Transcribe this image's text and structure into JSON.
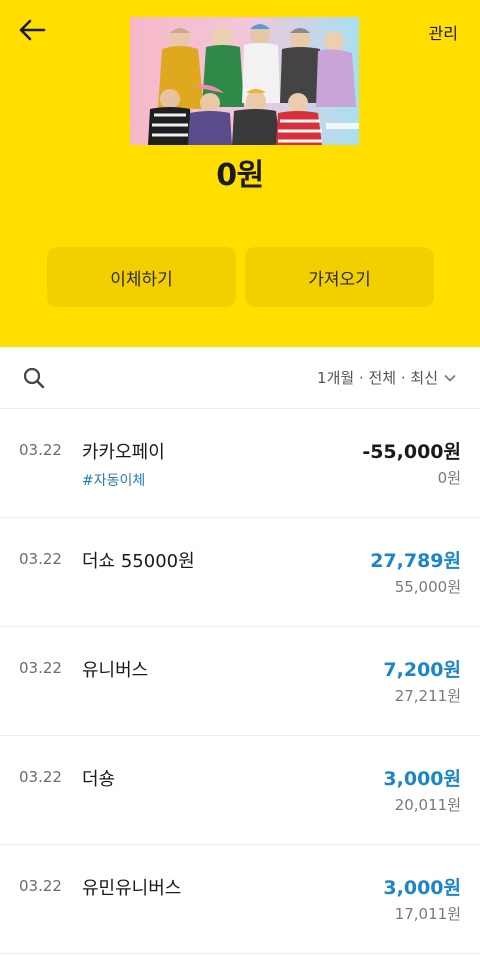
{
  "header": {
    "manage_label": "관리",
    "balance": "0원",
    "bg_color": "#ffde00"
  },
  "actions": {
    "transfer_label": "이체하기",
    "fetch_label": "가져오기"
  },
  "filter": {
    "label": "1개월 · 전체 · 최신"
  },
  "transactions": [
    {
      "date": "03.22",
      "name": "카카오페이",
      "tag": "#자동이체",
      "amount": "-55,000원",
      "balance": "0원",
      "type": "out"
    },
    {
      "date": "03.22",
      "name": "더쇼 55000원",
      "tag": "",
      "amount": "27,789원",
      "balance": "55,000원",
      "type": "in"
    },
    {
      "date": "03.22",
      "name": "유니버스",
      "tag": "",
      "amount": "7,200원",
      "balance": "27,211원",
      "type": "in"
    },
    {
      "date": "03.22",
      "name": "더숑",
      "tag": "",
      "amount": "3,000원",
      "balance": "20,011원",
      "type": "in"
    },
    {
      "date": "03.22",
      "name": "유민유니버스",
      "tag": "",
      "amount": "3,000원",
      "balance": "17,011원",
      "type": "in"
    }
  ],
  "colors": {
    "accent_blue": "#1a86c8",
    "tag_blue": "#2a7bb5"
  }
}
